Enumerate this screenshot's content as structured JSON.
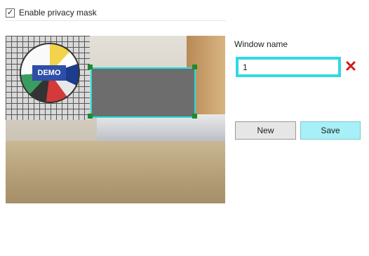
{
  "privacy_mask": {
    "enabled": true,
    "label": "Enable privacy mask",
    "check_mark": "✓"
  },
  "video": {
    "test_pattern_text": "DEMO"
  },
  "window_name": {
    "label": "Window name",
    "value": "1"
  },
  "buttons": {
    "new_label": "New",
    "save_label": "Save"
  },
  "icons": {
    "clear": "close-x-icon",
    "check": "checkmark-icon"
  },
  "colors": {
    "mask_border": "#21e0e0",
    "mask_fill": "#6d6d6d",
    "input_highlight": "#30d9e6",
    "save_button": "#a8f0f7",
    "clear_icon": "#d11a1a"
  }
}
